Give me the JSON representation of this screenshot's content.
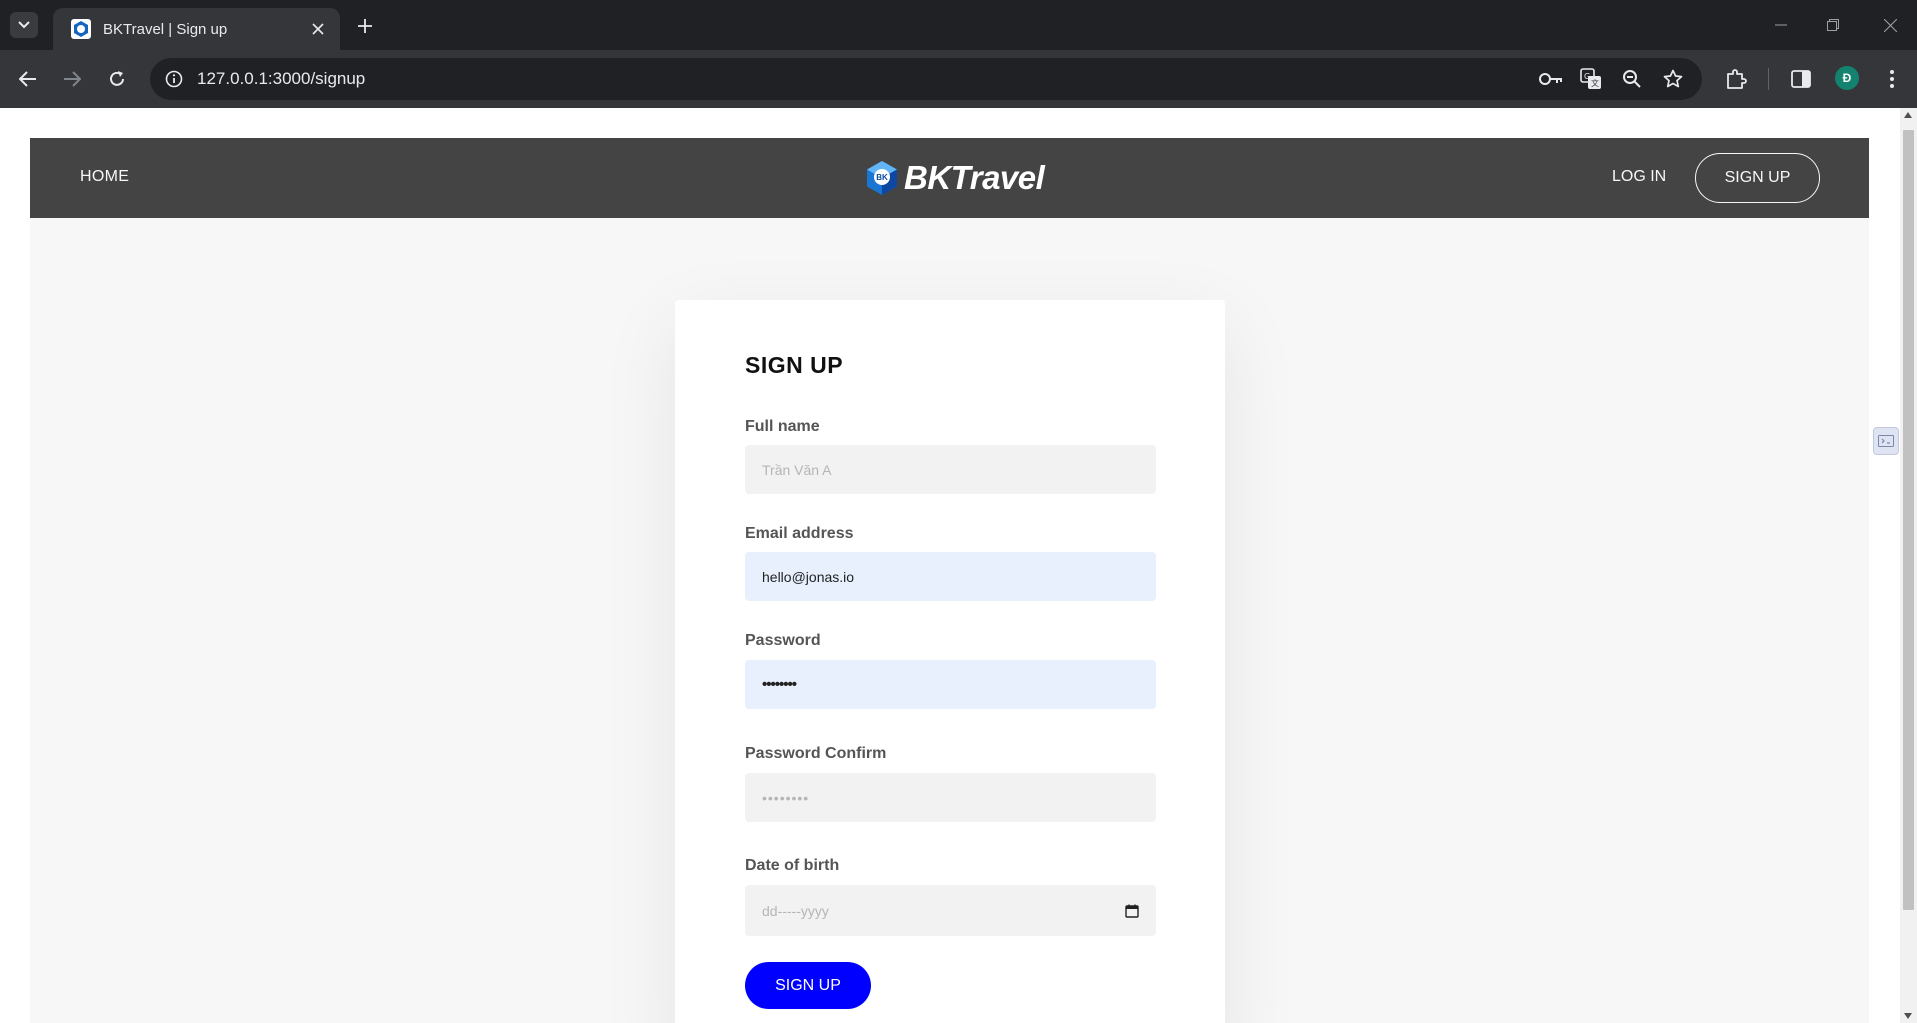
{
  "browser": {
    "tab_title": "BKTravel | Sign up",
    "url": "127.0.0.1:3000/signup",
    "profile_initial": "Đ"
  },
  "header": {
    "home_label": "HOME",
    "logo_text": "BKTravel",
    "logo_badge": "BK",
    "login_label": "LOG IN",
    "signup_label": "SIGN UP"
  },
  "form": {
    "heading": "SIGN UP",
    "full_name": {
      "label": "Full name",
      "placeholder": "Trần Văn A",
      "value": ""
    },
    "email": {
      "label": "Email address",
      "value": "hello@jonas.io"
    },
    "password": {
      "label": "Password",
      "value": "••••••••"
    },
    "password_confirm": {
      "label": "Password Confirm",
      "placeholder": "••••••••"
    },
    "date_of_birth": {
      "label": "Date of birth",
      "placeholder": "dd-----yyyy"
    },
    "submit_label": "SIGN UP"
  },
  "colors": {
    "header_bg": "#444444",
    "page_bg": "#f7f7f7",
    "submit_bg": "#0000ff",
    "autofill_bg": "#e8f0fe",
    "logo_blue": "#1565c0"
  },
  "icons": [
    "tab-list-icon",
    "close-icon",
    "plus-icon",
    "back-icon",
    "forward-icon",
    "reload-icon",
    "info-icon",
    "key-icon",
    "translate-icon",
    "zoom-icon",
    "star-icon",
    "extensions-icon",
    "side-panel-icon",
    "more-icon",
    "calendar-icon"
  ]
}
